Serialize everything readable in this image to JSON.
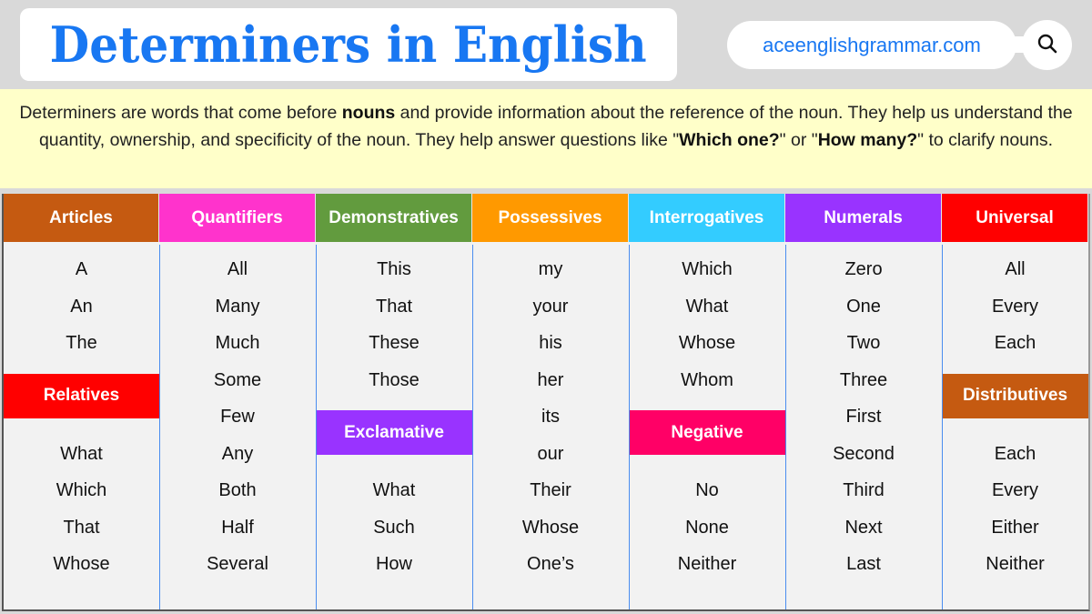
{
  "header": {
    "title": "Determiners in English",
    "site": "aceenglishgrammar.com",
    "search_icon": "search-icon"
  },
  "intro": {
    "part1": "Determiners are words that come before ",
    "bold1": "nouns",
    "part2": " and provide information about the reference of the noun. They help us understand the quantity, ownership, and specificity of the noun. They help answer questions like \"",
    "bold2": "Which one?",
    "part3": "\" or \"",
    "bold3": "How many?",
    "part4": "\" to clarify nouns."
  },
  "colors": {
    "title_blue": "#1877f2",
    "articles": "#c55a11",
    "quantifiers": "#ff33cc",
    "demonstratives": "#629b3e",
    "possessives": "#ff9900",
    "interrogatives": "#33ccff",
    "numerals": "#9933ff",
    "universal": "#ff0000",
    "relatives": "#ff0000",
    "exclamative": "#9933ff",
    "negative": "#ff0066",
    "distributives": "#c55a11"
  },
  "columns": [
    {
      "header": "Articles",
      "words": [
        "A",
        "An",
        "The"
      ],
      "sub": {
        "header": "Relatives",
        "words": [
          "What",
          "Which",
          "That",
          "Whose"
        ]
      }
    },
    {
      "header": "Quantifiers",
      "words": [
        "All",
        "Many",
        "Much",
        "Some",
        "Few",
        "Any",
        "Both",
        "Half",
        "Several"
      ]
    },
    {
      "header": "Demonstratives",
      "words": [
        "This",
        "That",
        "These",
        "Those"
      ],
      "sub": {
        "header": "Exclamative",
        "words": [
          "What",
          "Such",
          "How"
        ]
      }
    },
    {
      "header": "Possessives",
      "words": [
        "my",
        "your",
        "his",
        "her",
        "its",
        "our",
        "Their",
        "Whose",
        "One’s"
      ]
    },
    {
      "header": "Interrogatives",
      "words": [
        "Which",
        "What",
        "Whose",
        "Whom"
      ],
      "sub": {
        "header": "Negative",
        "words": [
          "No",
          "None",
          "Neither"
        ]
      }
    },
    {
      "header": "Numerals",
      "words": [
        "Zero",
        "One",
        "Two",
        "Three",
        "First",
        "Second",
        "Third",
        "Next",
        "Last"
      ]
    },
    {
      "header": "Universal",
      "words": [
        "All",
        "Every",
        "Each"
      ],
      "sub": {
        "header": "Distributives",
        "words": [
          "Each",
          "Every",
          "Either",
          "Neither"
        ]
      }
    }
  ]
}
